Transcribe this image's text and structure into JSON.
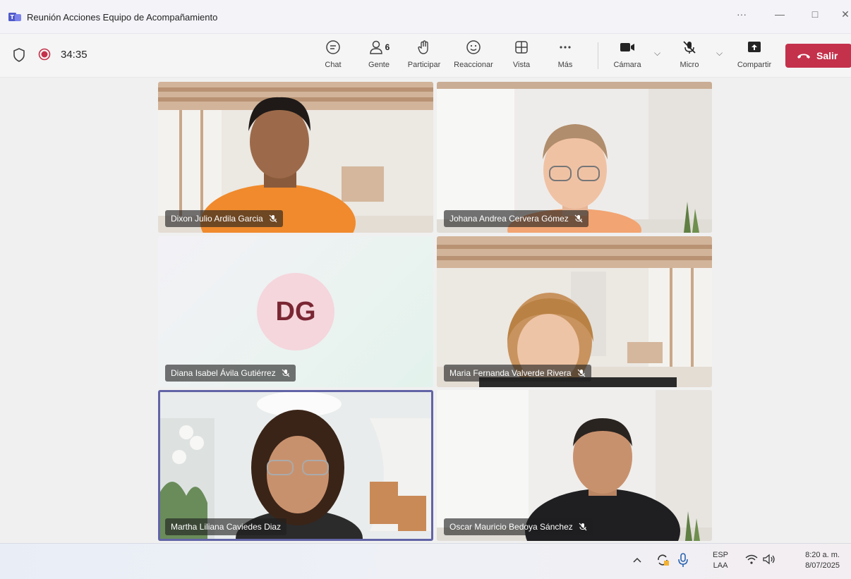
{
  "window": {
    "title": "Reunión Acciones Equipo de Acompañamiento",
    "more": "···",
    "minimize": "—",
    "maximize": "□",
    "close": "✕"
  },
  "meeting": {
    "timer": "34:35",
    "people_count": "6"
  },
  "toolbar": {
    "chat": "Chat",
    "people": "Gente",
    "raise": "Participar",
    "react": "Reaccionar",
    "view": "Vista",
    "more": "Más",
    "camera": "Cámara",
    "mic": "Micro",
    "share": "Compartir",
    "leave": "Salir"
  },
  "participants": [
    {
      "name": "Dixon Julio Ardila Garcia",
      "muted": true
    },
    {
      "name": "Johana Andrea Cervera Gómez",
      "muted": true
    },
    {
      "name": "Diana Isabel Ávila Gutiérrez",
      "muted": true,
      "initials": "DG"
    },
    {
      "name": "Maria Fernanda Valverde Rivera",
      "muted": true
    },
    {
      "name": "Martha Liliana Caviedes Diaz",
      "muted": false,
      "active": true
    },
    {
      "name": "Oscar Mauricio Bedoya Sánchez",
      "muted": true
    }
  ],
  "taskbar": {
    "lang_top": "ESP",
    "lang_bottom": "LAA",
    "time": "8:20 a. m.",
    "date": "8/07/2025"
  },
  "colors": {
    "accent": "#6264a7",
    "leave": "#c4314b",
    "record": "#c4314b"
  }
}
